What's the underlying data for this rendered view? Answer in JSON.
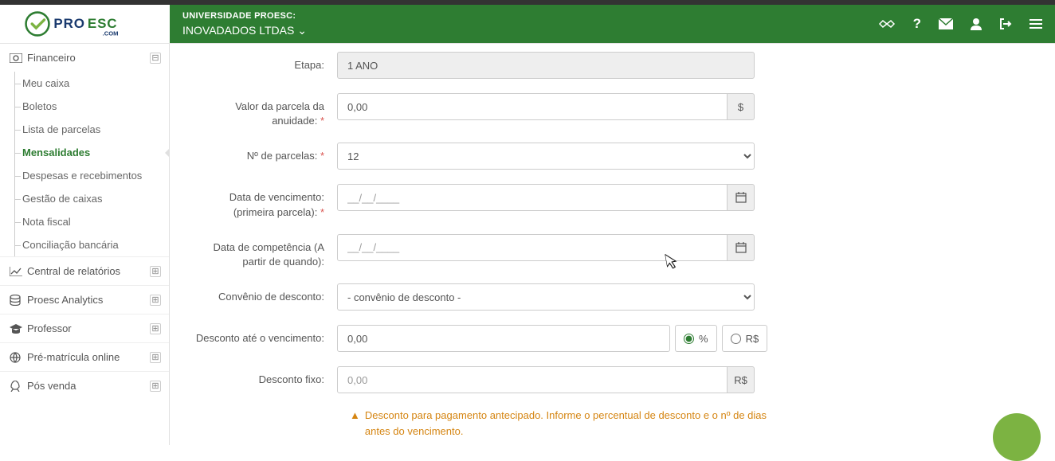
{
  "header": {
    "university_label": "UNIVERSIDADE PROESC:",
    "tenant": "INOVADADOS LTDAS"
  },
  "sidebar": {
    "financeiro": {
      "label": "Financeiro"
    },
    "items": [
      {
        "label": "Meu caixa"
      },
      {
        "label": "Boletos"
      },
      {
        "label": "Lista de parcelas"
      },
      {
        "label": "Mensalidades"
      },
      {
        "label": "Despesas e recebimentos"
      },
      {
        "label": "Gestão de caixas"
      },
      {
        "label": "Nota fiscal"
      },
      {
        "label": "Conciliação bancária"
      }
    ],
    "relatorios": {
      "label": "Central de relatórios"
    },
    "analytics": {
      "label": "Proesc Analytics"
    },
    "professor": {
      "label": "Professor"
    },
    "prematricula": {
      "label": "Pré-matrícula online"
    },
    "posvenda": {
      "label": "Pós venda"
    }
  },
  "form": {
    "etapa": {
      "label": "Etapa:",
      "value": "1 ANO"
    },
    "valor_parcela": {
      "label": "Valor da parcela da anuidade: ",
      "value": "0,00",
      "addon": "$"
    },
    "n_parcelas": {
      "label": "Nº de parcelas: ",
      "value": "12"
    },
    "data_venc": {
      "label": "Data de vencimento: (primeira parcela): ",
      "placeholder": "__/__/____"
    },
    "data_comp": {
      "label": "Data de competência (A partir de quando):",
      "placeholder": "__/__/____"
    },
    "convenio": {
      "label": "Convênio de desconto:",
      "placeholder": "- convênio de desconto -"
    },
    "desc_venc": {
      "label": "Desconto até o vencimento:",
      "value": "0,00",
      "opt_pct": "%",
      "opt_rs": "R$"
    },
    "desc_fixo": {
      "label": "Desconto fixo:",
      "placeholder": "0,00",
      "addon": "R$"
    },
    "warn": "Desconto para pagamento antecipado. Informe o percentual de desconto e o nº de dias antes do vencimento."
  }
}
